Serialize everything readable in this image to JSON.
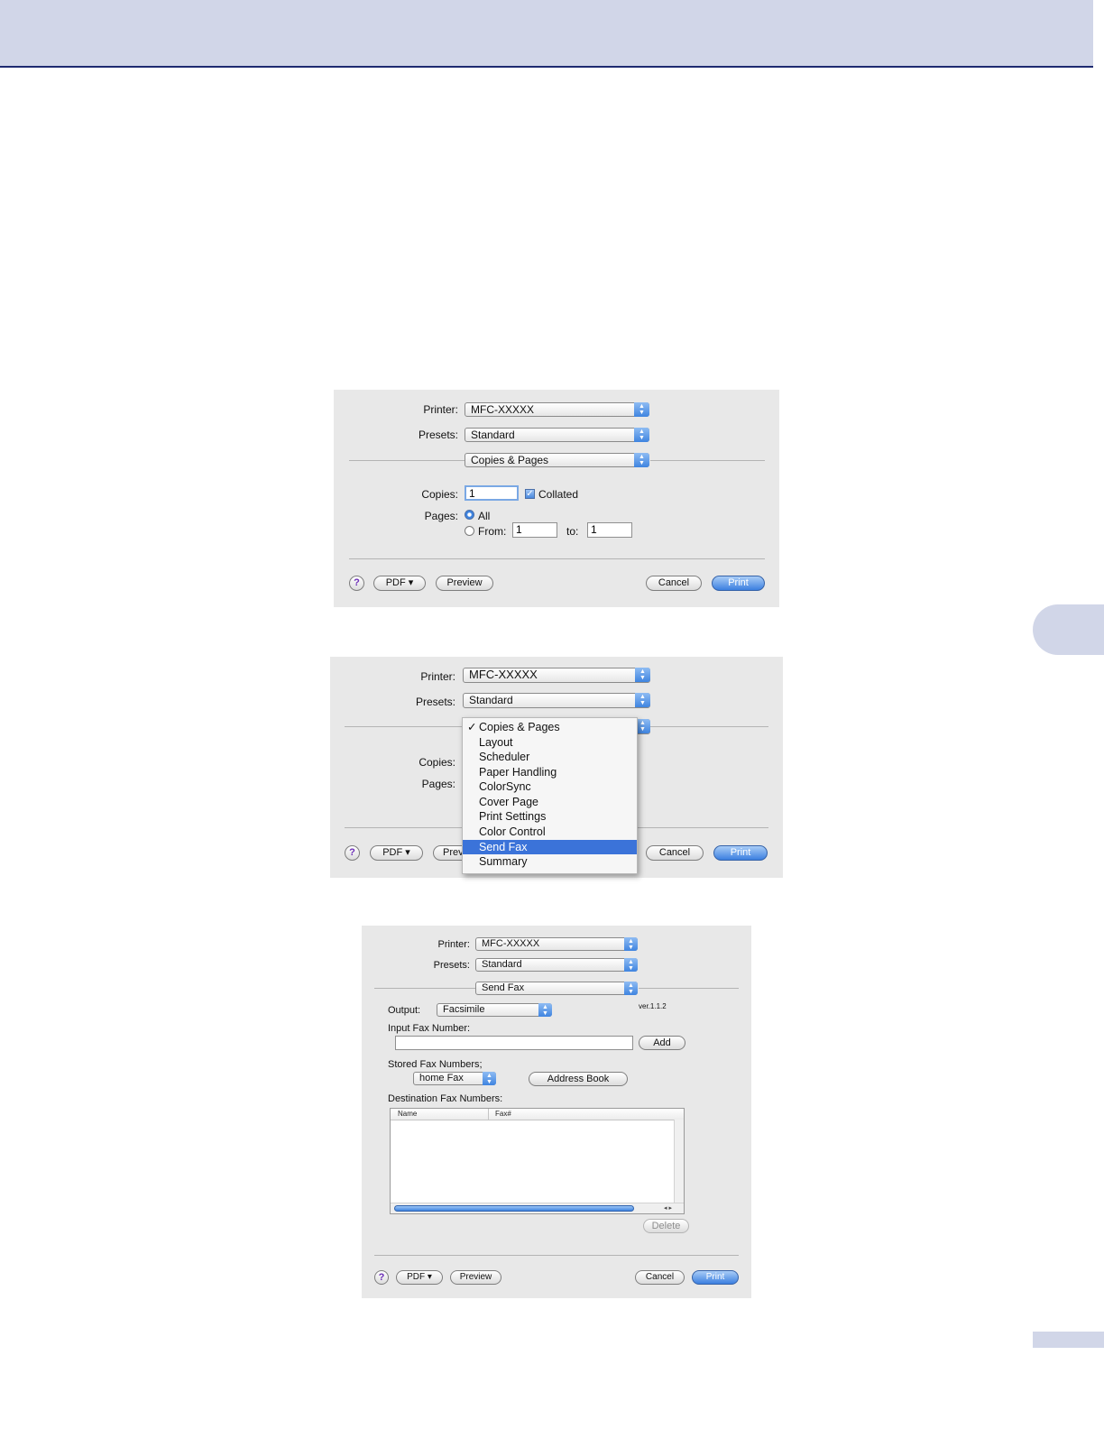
{
  "dialog1": {
    "printer_label": "Printer:",
    "printer_value": "MFC-XXXXX",
    "presets_label": "Presets:",
    "presets_value": "Standard",
    "panel_value": "Copies & Pages",
    "copies_label": "Copies:",
    "copies_value": "1",
    "collated_label": "Collated",
    "collated_checked": true,
    "pages_label": "Pages:",
    "all_label": "All",
    "from_label": "From:",
    "from_value": "1",
    "to_label": "to:",
    "to_value": "1",
    "help_label": "?",
    "pdf_label": "PDF ▾",
    "preview_label": "Preview",
    "cancel_label": "Cancel",
    "print_label": "Print"
  },
  "dialog2": {
    "printer_label": "Printer:",
    "printer_value": "MFC-XXXXX",
    "presets_label": "Presets:",
    "presets_value": "Standard",
    "copies_label": "Copies:",
    "pages_label": "Pages:",
    "help_label": "?",
    "pdf_label": "PDF ▾",
    "preview_label": "Prev",
    "cancel_label": "Cancel",
    "print_label": "Print",
    "menu": {
      "check_mark": "✓",
      "items": [
        "Copies & Pages",
        "Layout",
        "Scheduler",
        "Paper Handling",
        "ColorSync",
        "Cover Page",
        "Print Settings",
        "Color Control",
        "Send Fax",
        "Summary"
      ],
      "checked_item": "Copies & Pages",
      "highlighted_item": "Send Fax"
    }
  },
  "dialog3": {
    "printer_label": "Printer:",
    "printer_value": "MFC-XXXXX",
    "presets_label": "Presets:",
    "presets_value": "Standard",
    "panel_value": "Send Fax",
    "version": "ver.1.1.2",
    "output_label": "Output:",
    "output_value": "Facsimile",
    "input_fax_label": "Input Fax Number:",
    "input_fax_value": "",
    "add_label": "Add",
    "stored_label": "Stored Fax Numbers;",
    "stored_value": "home Fax",
    "address_book_label": "Address Book",
    "destination_label": "Destination Fax Numbers:",
    "columns": [
      "Name",
      "Fax#"
    ],
    "delete_label": "Delete",
    "help_label": "?",
    "pdf_label": "PDF ▾",
    "preview_label": "Preview",
    "cancel_label": "Cancel",
    "print_label": "Print"
  },
  "icons": {
    "popup_arrows": "▲▼",
    "scroll_arrows": "◂ ▸",
    "checkbox_mark": "✓"
  },
  "colors": {
    "header_band": "#d1d6e8",
    "header_rule": "#1e2a70",
    "accent_blue": "#3f84e0",
    "menu_highlight": "#3b73d9"
  }
}
